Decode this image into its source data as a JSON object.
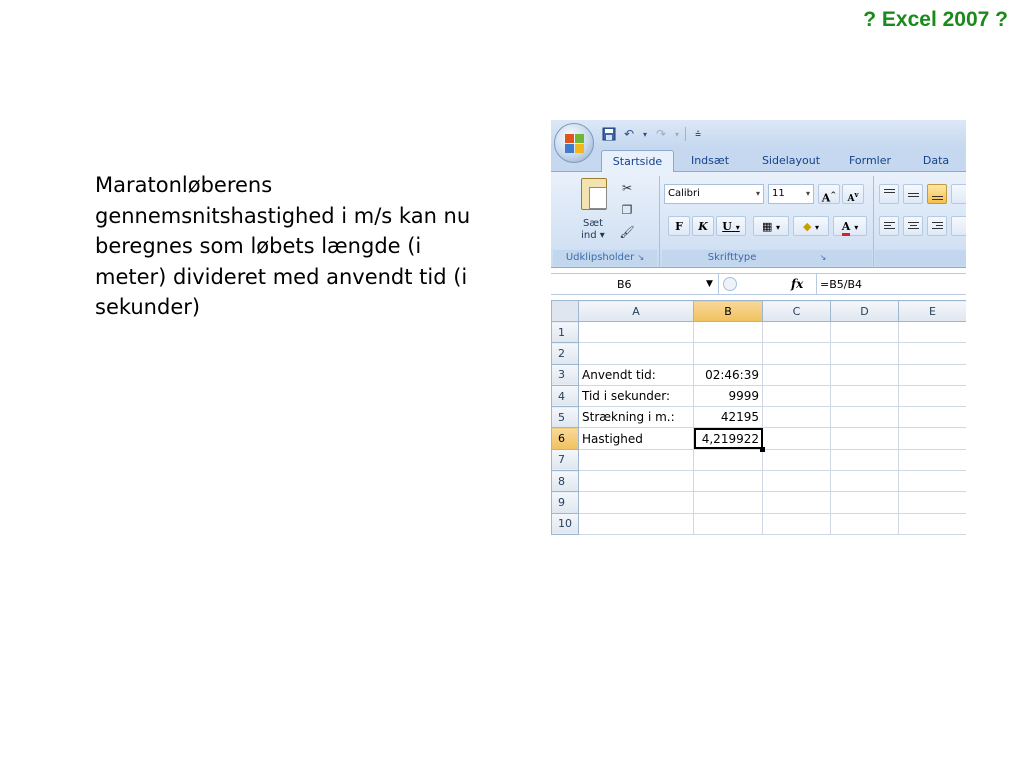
{
  "slide": {
    "title": "? Excel 2007 ?",
    "body": "Maratonløberens gennemsnitshastighed i m/s kan nu beregnes som løbets længde (i meter) divideret med anvendt tid (i sekunder)"
  },
  "excel": {
    "tabs": [
      "Startside",
      "Indsæt",
      "Sidelayout",
      "Formler",
      "Data"
    ],
    "ribbon": {
      "clipboard": {
        "paste_label": "Sæt ind",
        "group_label": "Udklipsholder"
      },
      "font": {
        "name": "Calibri",
        "size": "11",
        "bold": "F",
        "italic": "K",
        "underline": "U",
        "group_label": "Skrifttype"
      }
    },
    "formula_bar": {
      "name_box": "B6",
      "fx": "fx",
      "formula": "=B5/B4"
    },
    "columns": [
      "A",
      "B",
      "C",
      "D",
      "E"
    ],
    "rows": [
      {
        "num": "1",
        "a": "",
        "b": ""
      },
      {
        "num": "2",
        "a": "",
        "b": ""
      },
      {
        "num": "3",
        "a": "Anvendt tid:",
        "b": "02:46:39"
      },
      {
        "num": "4",
        "a": "Tid i sekunder:",
        "b": "9999"
      },
      {
        "num": "5",
        "a": "Strækning i m.:",
        "b": "42195"
      },
      {
        "num": "6",
        "a": "Hastighed",
        "b": "4,219922"
      },
      {
        "num": "7",
        "a": "",
        "b": ""
      },
      {
        "num": "8",
        "a": "",
        "b": ""
      },
      {
        "num": "9",
        "a": "",
        "b": ""
      },
      {
        "num": "10",
        "a": "",
        "b": ""
      }
    ]
  }
}
